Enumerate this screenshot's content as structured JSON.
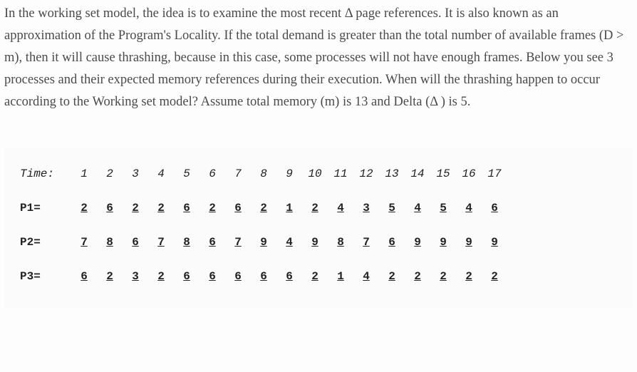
{
  "paragraph": "In the working set model, the idea is to examine the most recent Δ page references. It is also known as an approximation of the Program's Locality.  If the total demand is greater than the total number of available frames (D > m), then it will cause thrashing, because in this case, some processes will not have enough frames.   Below you see 3 processes and their expected memory references during their execution. When will the thrashing happen to occur according to the Working set model?  Assume total memory (m) is 13 and Delta (Δ ) is 5.",
  "table": {
    "time_label": "Time:",
    "times": [
      "1",
      "2",
      "3",
      "4",
      "5",
      "6",
      "7",
      "8",
      "9",
      "10",
      "11",
      "12",
      "13",
      "14",
      "15",
      "16",
      "17"
    ],
    "rows": [
      {
        "label": "P1=",
        "values": [
          "2",
          "6",
          "2",
          "2",
          "6",
          "2",
          "6",
          "2",
          "1",
          "2",
          "4",
          "3",
          "5",
          "4",
          "5",
          "4",
          "6"
        ]
      },
      {
        "label": "P2=",
        "values": [
          "7",
          "8",
          "6",
          "7",
          "8",
          "6",
          "7",
          "9",
          "4",
          "9",
          "8",
          "7",
          "6",
          "9",
          "9",
          "9",
          "9"
        ]
      },
      {
        "label": "P3=",
        "values": [
          "6",
          "2",
          "3",
          "2",
          "6",
          "6",
          "6",
          "6",
          "6",
          "2",
          "1",
          "4",
          "2",
          "2",
          "2",
          "2",
          "2"
        ]
      }
    ]
  }
}
